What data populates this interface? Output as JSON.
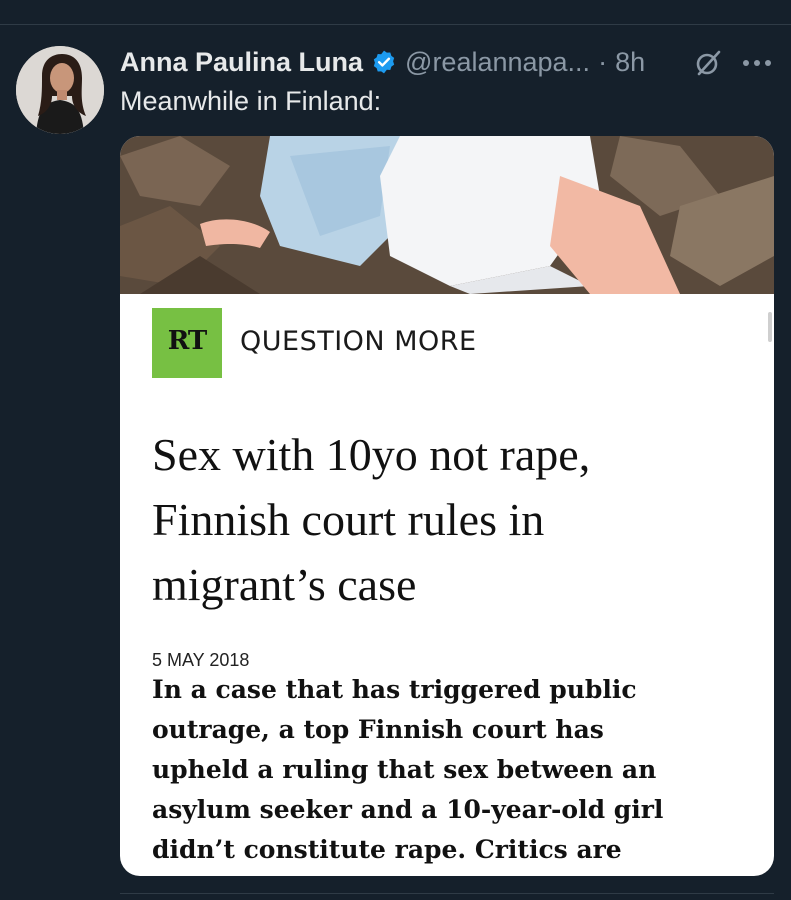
{
  "tweet": {
    "display_name": "Anna Paulina Luna",
    "handle": "@realannapa...",
    "separator": "·",
    "time": "8h",
    "text": "Meanwhile in Finland:"
  },
  "icons": {
    "avatar": "avatar-photo",
    "verified": "verified-badge-icon",
    "grok": "grok-icon",
    "more": "more-icon"
  },
  "article": {
    "logo_text": "RT",
    "tagline": "QUESTION MORE",
    "headline_lines": [
      "Sex with 10yo not rape,",
      "Finnish court rules in",
      "migrant’s case"
    ],
    "date": "5 MAY 2018",
    "body_lines": [
      "In a case that has triggered public",
      "outrage, a top Finnish court has",
      "upheld a ruling that sex between an",
      "asylum seeker and a 10-year-old girl",
      "didn’t constitute rape. Critics are"
    ]
  },
  "colors": {
    "background": "#15202b",
    "verified": "#1d9bf0",
    "rt_green": "#77c043",
    "secondary_text": "#8b98a5"
  }
}
